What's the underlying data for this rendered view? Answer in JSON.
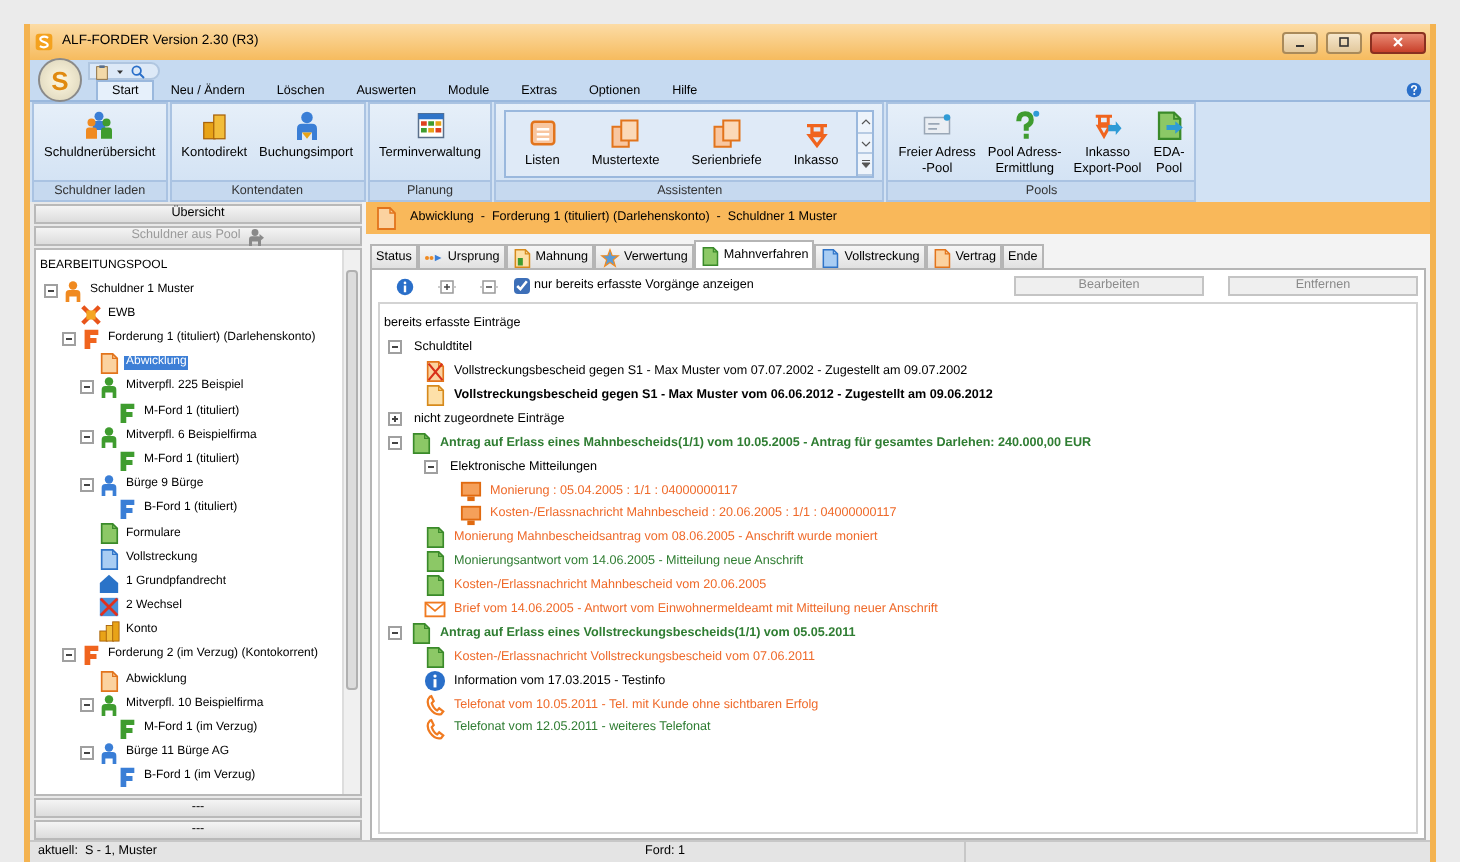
{
  "window": {
    "title": "ALF-FORDER Version 2.30 (R3)"
  },
  "app_button": {
    "label": "S"
  },
  "ribbon_tabs": [
    {
      "label": "Start",
      "selected": true
    },
    {
      "label": "Neu / Ändern",
      "selected": false
    },
    {
      "label": "Löschen",
      "selected": false
    },
    {
      "label": "Auswerten",
      "selected": false
    },
    {
      "label": "Module",
      "selected": false
    },
    {
      "label": "Extras",
      "selected": false
    },
    {
      "label": "Optionen",
      "selected": false
    },
    {
      "label": "Hilfe",
      "selected": false
    }
  ],
  "ribbon_groups": [
    {
      "label": "Schuldner laden",
      "kind": "plain",
      "items": [
        {
          "label": "Schuldnerübersicht"
        }
      ]
    },
    {
      "label": "Kontendaten",
      "kind": "plain",
      "items": [
        {
          "label": "Kontodirekt"
        },
        {
          "label": "Buchungsimport"
        }
      ]
    },
    {
      "label": "Planung",
      "kind": "plain",
      "items": [
        {
          "label": "Terminverwaltung"
        }
      ]
    },
    {
      "label": "Assistenten",
      "kind": "gallery",
      "items": [
        {
          "label": "Listen"
        },
        {
          "label": "Mustertexte"
        },
        {
          "label": "Serienbriefe"
        },
        {
          "label": "Inkasso"
        }
      ]
    },
    {
      "label": "Pools",
      "kind": "plain",
      "items": [
        {
          "label": "Freier Adress\n-Pool"
        },
        {
          "label": "Pool Adress-\nErmittlung"
        },
        {
          "label": "Inkasso\nExport-Pool"
        },
        {
          "label": "EDA-\nPool"
        }
      ]
    }
  ],
  "left_panel": {
    "buttons": [
      {
        "label": "Übersicht",
        "disabled": false
      },
      {
        "label": "Schuldner aus Pool",
        "disabled": true
      }
    ],
    "tree_title": "BEARBEITUNGSPOOL",
    "tree": [
      {
        "kind": "debtor",
        "label": "Schuldner 1 Muster",
        "selected": false,
        "expanded": true,
        "children": [
          {
            "kind": "ewb",
            "label": "EWB",
            "selected": false
          },
          {
            "kind": "claim",
            "label": "Forderung 1 (tituliert) (Darlehenskonto)",
            "selected": false,
            "expanded": true,
            "children": [
              {
                "kind": "settlement",
                "label": "Abwicklung",
                "selected": true
              },
              {
                "kind": "co-debtor",
                "label": "Mitverpfl. 225 Beispiel",
                "selected": false,
                "expanded": true,
                "children": [
                  {
                    "kind": "sub-claim",
                    "label": "M-Ford 1 (tituliert)",
                    "selected": false
                  }
                ]
              },
              {
                "kind": "co-debtor",
                "label": "Mitverpfl. 6 Beispielfirma",
                "selected": false,
                "expanded": true,
                "children": [
                  {
                    "kind": "sub-claim",
                    "label": "M-Ford 1 (tituliert)",
                    "selected": false
                  }
                ]
              },
              {
                "kind": "guarantor",
                "label": "Bürge 9 Bürge",
                "selected": false,
                "expanded": true,
                "children": [
                  {
                    "kind": "guarantee-claim",
                    "label": "B-Ford 1 (tituliert)",
                    "selected": false
                  }
                ]
              },
              {
                "kind": "form",
                "label": "Formulare",
                "selected": false
              },
              {
                "kind": "enforcement",
                "label": "Vollstreckung",
                "selected": false
              },
              {
                "kind": "land-charge",
                "label": "1 Grundpfandrecht",
                "selected": false
              },
              {
                "kind": "bill",
                "label": "2 Wechsel",
                "selected": false
              },
              {
                "kind": "account",
                "label": "Konto",
                "selected": false
              }
            ]
          },
          {
            "kind": "claim",
            "label": "Forderung 2 (im Verzug) (Kontokorrent)",
            "selected": false,
            "expanded": true,
            "children": [
              {
                "kind": "settlement",
                "label": "Abwicklung",
                "selected": false
              },
              {
                "kind": "co-debtor",
                "label": "Mitverpfl. 10 Beispielfirma",
                "selected": false,
                "expanded": true,
                "children": [
                  {
                    "kind": "sub-claim",
                    "label": "M-Ford 1 (im Verzug)",
                    "selected": false
                  }
                ]
              },
              {
                "kind": "guarantor",
                "label": "Bürge 11 Bürge AG",
                "selected": false,
                "expanded": true,
                "children": [
                  {
                    "kind": "guarantee-claim",
                    "label": "B-Ford 1 (im Verzug)",
                    "selected": false
                  }
                ]
              }
            ]
          }
        ]
      }
    ],
    "footer_buttons": [
      "---",
      "---"
    ]
  },
  "breadcrumb": "Abwicklung  -  Forderung 1 (tituliert) (Darlehenskonto)  -  Schuldner 1 Muster",
  "content_tabs": [
    {
      "label": "Status",
      "selected": false
    },
    {
      "label": "Ursprung",
      "selected": false
    },
    {
      "label": "Mahnung",
      "selected": false
    },
    {
      "label": "Verwertung",
      "selected": false
    },
    {
      "label": "Mahnverfahren",
      "selected": true
    },
    {
      "label": "Vollstreckung",
      "selected": false
    },
    {
      "label": "Vertrag",
      "selected": false
    },
    {
      "label": "Ende",
      "selected": false
    }
  ],
  "toolbar": {
    "filter": {
      "label": "nur bereits erfasste Vorgänge anzeigen",
      "checked": true
    },
    "buttons": [
      {
        "label": "Bearbeiten",
        "disabled": true
      },
      {
        "label": "Entfernen",
        "disabled": true
      }
    ]
  },
  "entries": {
    "heading": "bereits erfasste Einträge",
    "tree": [
      {
        "kind": "group",
        "label": "Schuldtitel",
        "expanded": true,
        "children": [
          {
            "kind": "cancelled-document",
            "label": "Vollstreckungsbescheid gegen S1 - Max Muster vom 07.07.2002 - Zugestellt am 09.07.2002",
            "bold": false,
            "color": "#000000"
          },
          {
            "kind": "document",
            "label": "Vollstreckungsbescheid gegen S1 - Max Muster vom 06.06.2012 - Zugestellt am 09.06.2012",
            "bold": true,
            "color": "#000000"
          }
        ]
      },
      {
        "kind": "group",
        "label": "nicht zugeordnete Einträge",
        "expanded": false
      },
      {
        "kind": "green-document",
        "label": "Antrag auf Erlass eines Mahnbescheids(1/1) vom 10.05.2005 - Antrag für gesamtes Darlehen: 240.000,00 EUR",
        "bold": true,
        "color": "#2f7d32",
        "expanded": true,
        "children": [
          {
            "kind": "group",
            "label": "Elektronische Mitteilungen",
            "expanded": true,
            "children": [
              {
                "kind": "monitor",
                "label": "Monierung : 05.04.2005 : 1/1 : 04000000117",
                "bold": false,
                "color": "#ef6a2a"
              },
              {
                "kind": "monitor",
                "label": "Kosten-/Erlassnachricht Mahnbescheid : 20.06.2005 : 1/1 : 04000000117",
                "bold": false,
                "color": "#ef6a2a"
              }
            ]
          },
          {
            "kind": "green-document",
            "label": "Monierung Mahnbescheidsantrag vom 08.06.2005 - Anschrift wurde moniert",
            "bold": false,
            "color": "#ef6a2a"
          },
          {
            "kind": "green-document",
            "label": "Monierungsantwort vom 14.06.2005 - Mitteilung neue Anschrift",
            "bold": false,
            "color": "#2f7d32"
          },
          {
            "kind": "green-document",
            "label": "Kosten-/Erlassnachricht Mahnbescheid vom 20.06.2005",
            "bold": false,
            "color": "#ef6a2a"
          },
          {
            "kind": "letter",
            "label": "Brief vom 14.06.2005 - Antwort vom Einwohnermeldeamt mit Mitteilung neuer Anschrift",
            "bold": false,
            "color": "#ef6a2a"
          }
        ]
      },
      {
        "kind": "green-document",
        "label": "Antrag auf Erlass eines Vollstreckungsbescheids(1/1) vom 05.05.2011",
        "bold": true,
        "color": "#2f7d32",
        "expanded": true,
        "children": [
          {
            "kind": "green-document",
            "label": "Kosten-/Erlassnachricht Vollstreckungsbescheid vom 07.06.2011",
            "bold": false,
            "color": "#ef6a2a"
          },
          {
            "kind": "info",
            "label": "Information vom 17.03.2015 - Testinfo",
            "bold": false,
            "color": "#000000"
          },
          {
            "kind": "phone",
            "label": "Telefonat vom 10.05.2011 - Tel. mit Kunde ohne sichtbaren Erfolg",
            "bold": false,
            "color": "#ef6a2a"
          },
          {
            "kind": "phone",
            "label": "Telefonat vom 12.05.2011 - weiteres Telefonat",
            "bold": false,
            "color": "#2f7d32"
          }
        ]
      }
    ]
  },
  "status_bar": [
    "aktuell:  S - 1, Muster",
    "Ford: 1"
  ]
}
